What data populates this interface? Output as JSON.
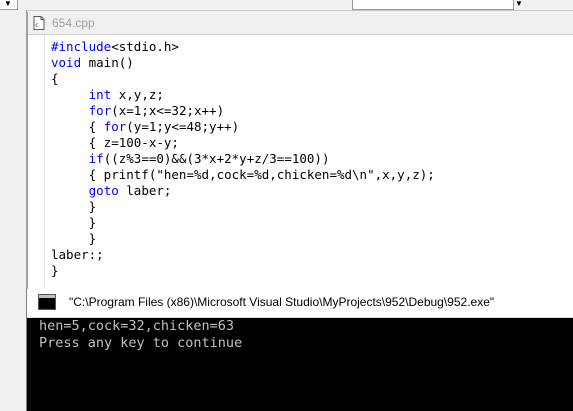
{
  "editor": {
    "tab_title": "654.cpp",
    "lines": [
      [
        {
          "t": "#include",
          "kw": true
        },
        {
          "t": "<stdio.h>",
          "kw": false
        }
      ],
      [
        {
          "t": "void",
          "kw": true
        },
        {
          "t": " main()",
          "kw": false
        }
      ],
      [
        {
          "t": "{",
          "kw": false
        }
      ],
      [
        {
          "t": "     ",
          "kw": false
        },
        {
          "t": "int",
          "kw": true
        },
        {
          "t": " x,y,z;",
          "kw": false
        }
      ],
      [
        {
          "t": "     ",
          "kw": false
        },
        {
          "t": "for",
          "kw": true
        },
        {
          "t": "(x=1;x<=32;x++)",
          "kw": false
        }
      ],
      [
        {
          "t": "     { ",
          "kw": false
        },
        {
          "t": "for",
          "kw": true
        },
        {
          "t": "(y=1;y<=48;y++)",
          "kw": false
        }
      ],
      [
        {
          "t": "     { z=100-x-y;",
          "kw": false
        }
      ],
      [
        {
          "t": "     ",
          "kw": false
        },
        {
          "t": "if",
          "kw": true
        },
        {
          "t": "((z%3==0)&&(3*x+2*y+z/3==100))",
          "kw": false
        }
      ],
      [
        {
          "t": "     { printf(\"hen=%d,cock=%d,chicken=%d\\n\",x,y,z);",
          "kw": false
        }
      ],
      [
        {
          "t": "     ",
          "kw": false
        },
        {
          "t": "goto",
          "kw": true
        },
        {
          "t": " laber;",
          "kw": false
        }
      ],
      [
        {
          "t": "     }",
          "kw": false
        }
      ],
      [
        {
          "t": "     }",
          "kw": false
        }
      ],
      [
        {
          "t": "     }",
          "kw": false
        }
      ],
      [
        {
          "t": "laber:;",
          "kw": false
        }
      ],
      [
        {
          "t": "}",
          "kw": false
        }
      ]
    ]
  },
  "console": {
    "title": "\"C:\\Program Files (x86)\\Microsoft Visual Studio\\MyProjects\\952\\Debug\\952.exe\"",
    "output": [
      "hen=5,cock=32,chicken=63",
      "Press any key to continue"
    ]
  },
  "colors": {
    "keyword": "#0000ff",
    "console_bg": "#000000",
    "console_text": "#c0c0c0"
  }
}
